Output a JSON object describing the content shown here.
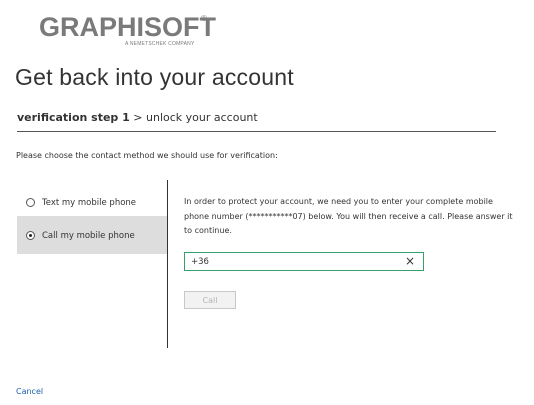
{
  "brand": {
    "logo_text": "GRAPHISOFT",
    "logo_reg": "®",
    "logo_tagline": "A NEMETSCHEK COMPANY"
  },
  "page": {
    "title": "Get back into your account"
  },
  "steps": {
    "current": "verification step 1",
    "separator": ">",
    "next": "unlock your account"
  },
  "instructions": "Please choose the contact method we should use for verification:",
  "contact_options": [
    {
      "label": "Text my mobile phone",
      "selected": false
    },
    {
      "label": "Call my mobile phone",
      "selected": true
    }
  ],
  "detail": {
    "message": "In order to protect your account, we need you to enter your complete mobile phone number (***********07) below. You will then receive a call. Please answer it to continue.",
    "phone_value": "+36",
    "clear_icon": "×",
    "call_label": "Call"
  },
  "footer": {
    "cancel_label": "Cancel"
  },
  "colors": {
    "selected_option_bg": "#dddddd",
    "input_focus_border": "#3a9e6a",
    "link": "#1a5fa8"
  }
}
